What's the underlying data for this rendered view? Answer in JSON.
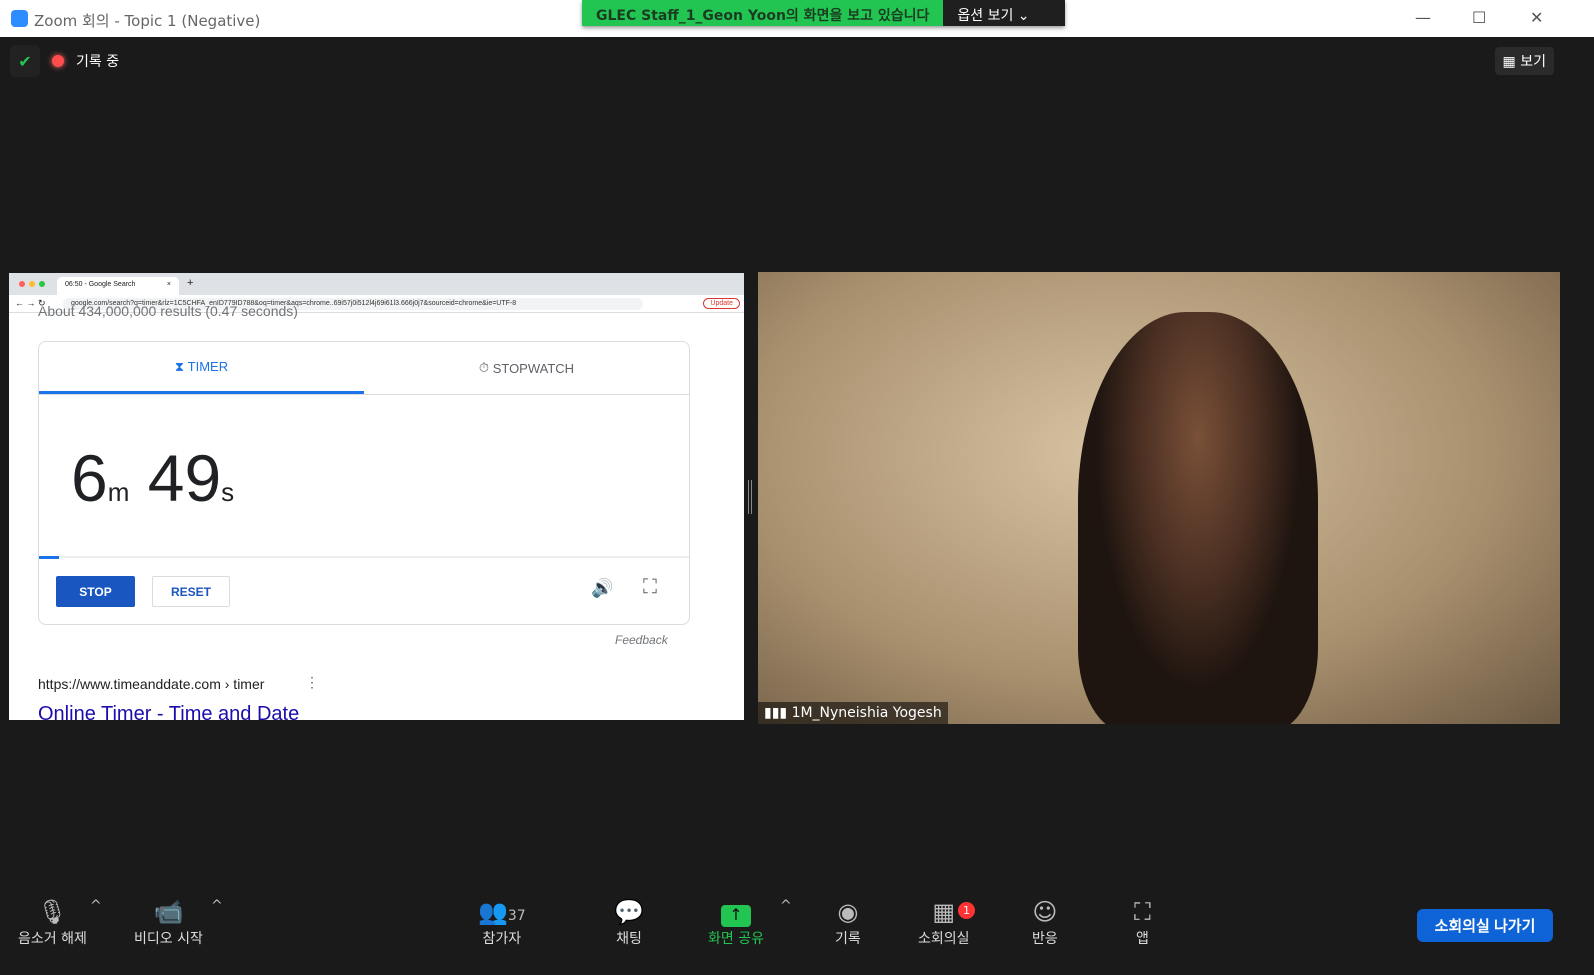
{
  "window": {
    "title": "Zoom 회의 - Topic 1 (Negative)",
    "minimize": "—",
    "maximize": "☐",
    "close": "✕"
  },
  "banner": {
    "text": "GLEC Staff_1_Geon Yoon의 화면을 보고 있습니다",
    "options": "옵션 보기 ⌄"
  },
  "status": {
    "recording": "기록 중",
    "view": "보기"
  },
  "browser": {
    "tab_title": "06:50 - Google Search",
    "url": "google.com/search?q=timer&rlz=1C5CHFA_enID779ID788&oq=timer&aqs=chrome..69i57j0i512l4j69i61l3.666j0j7&sourceid=chrome&ie=UTF-8",
    "update": "Update",
    "results_text": "About 434,000,000 results (0.47 seconds)"
  },
  "timer": {
    "tab_timer": "TIMER",
    "tab_stopwatch": "STOPWATCH",
    "minutes": "6",
    "m": "m",
    "seconds": "49",
    "s": "s",
    "progress_percent": 3,
    "stop": "STOP",
    "reset": "RESET",
    "feedback": "Feedback",
    "result_url": "https://www.timeanddate.com › timer",
    "result_title": "Online Timer - Time and Date"
  },
  "video": {
    "participant": "1M_Nyneishia Yogesh"
  },
  "toolbar": {
    "unmute": "음소거 해제",
    "start_video": "비디오 시작",
    "participants": "참가자",
    "participants_count": "37",
    "chat": "채팅",
    "share": "화면 공유",
    "record": "기록",
    "breakout": "소회의실",
    "breakout_badge": "1",
    "reactions": "반응",
    "apps": "앱",
    "leave_breakout": "소회의실 나가기"
  },
  "colors": {
    "green": "#23c552",
    "blue": "#0e64d6"
  }
}
